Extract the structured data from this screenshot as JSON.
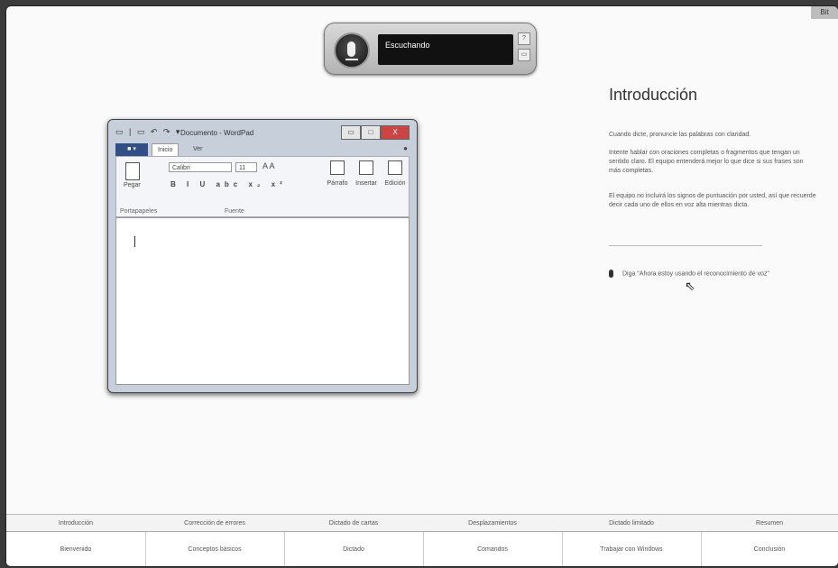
{
  "window_corner": "Bit",
  "speech": {
    "status": "Escuchando",
    "side_buttons": [
      "?",
      "▭"
    ]
  },
  "wordpad": {
    "title": "Documento - WordPad",
    "quick_access": "▭ | ▭ ↶ ↷ ▾",
    "controls": [
      "▭",
      "□",
      "X"
    ],
    "file_tab": "■ ▾",
    "tabs": [
      "Inicio",
      "Ver"
    ],
    "help": "●",
    "clipboard": {
      "paste_label": "Pegar",
      "group_label": "Portapapeles"
    },
    "font": {
      "family": "Calibri",
      "size": "11",
      "grow_shrink": "A  A",
      "format_buttons": "B I U abc x₂ x²",
      "group_label": "Fuente"
    },
    "big_buttons": [
      {
        "label": "Párrafo"
      },
      {
        "label": "Insertar"
      },
      {
        "label": "Edición"
      }
    ]
  },
  "panel": {
    "title": "Introducción",
    "paragraphs": [
      "Cuando dicte, pronuncie las palabras con claridad.",
      "Intente hablar con oraciones completas o fragmentos que tengan un sentido claro. El equipo entenderá mejor lo que dice si sus frases son más completas.",
      "El equipo no incluirá los signos de puntuación por usted, así que recuerde decir cada uno de ellos en voz alta mientras dicta."
    ],
    "say_prompt": "Diga \"Ahora estoy usando el reconocimiento de voz\""
  },
  "subnav": [
    "Introducción",
    "Corrección de errores",
    "Dictado de cartas",
    "Desplazamientos",
    "Dictado limitado",
    "Resumen"
  ],
  "mainnav": [
    "Bienvenido",
    "Conceptos básicos",
    "Dictado",
    "Comandos",
    "Trabajar con Windows",
    "Conclusión"
  ]
}
